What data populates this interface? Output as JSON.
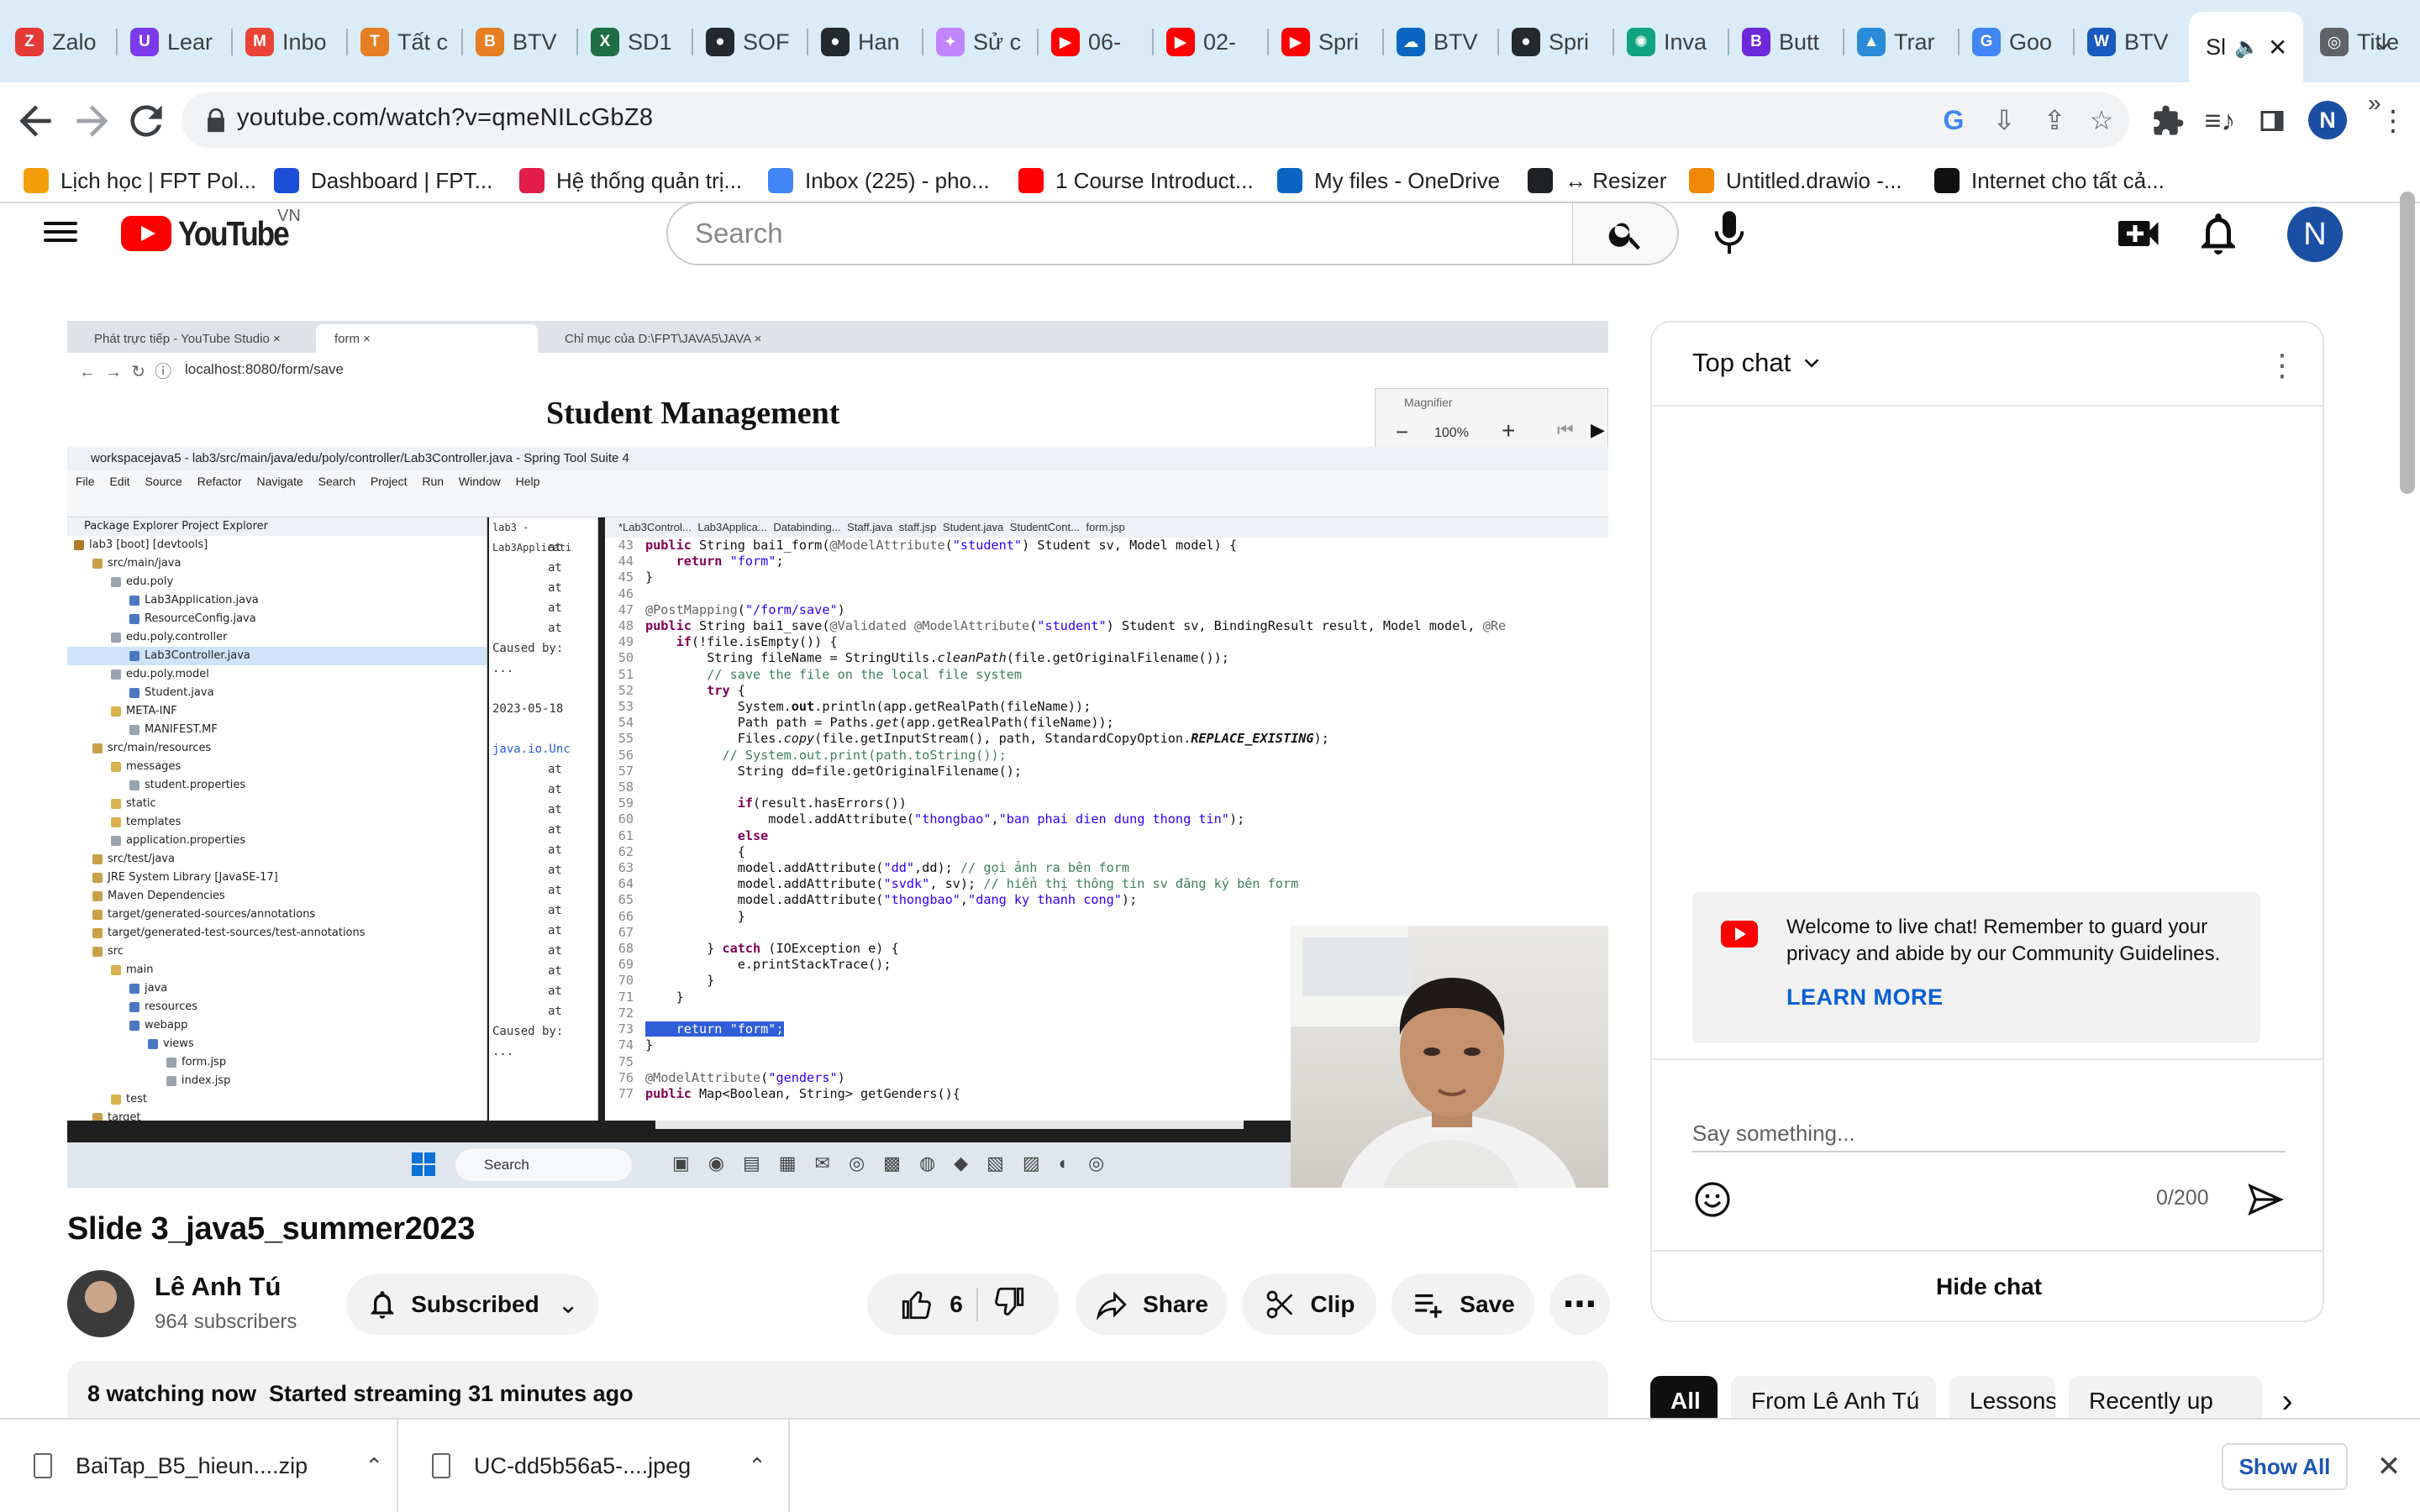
{
  "browser": {
    "tabs": [
      {
        "title": "Zalo",
        "fav": "Z",
        "color": "#e53935"
      },
      {
        "title": "Lear",
        "fav": "U",
        "color": "#7c3aed"
      },
      {
        "title": "Inbo",
        "fav": "M",
        "color": "#ea4335"
      },
      {
        "title": "Tất c",
        "fav": "T",
        "color": "#e67e22"
      },
      {
        "title": "BTV",
        "fav": "B",
        "color": "#e67e22"
      },
      {
        "title": "SD1",
        "fav": "X",
        "color": "#1d6f42"
      },
      {
        "title": "SOF",
        "fav": "●",
        "color": "#24292f"
      },
      {
        "title": "Han",
        "fav": "●",
        "color": "#24292f"
      },
      {
        "title": "Sử c",
        "fav": "✦",
        "color": "#c084fc"
      },
      {
        "title": "06-",
        "fav": "▶",
        "color": "#ff0000"
      },
      {
        "title": "02-",
        "fav": "▶",
        "color": "#ff0000"
      },
      {
        "title": "Spri",
        "fav": "▶",
        "color": "#ff0000"
      },
      {
        "title": "BTV",
        "fav": "☁",
        "color": "#0a66c2"
      },
      {
        "title": "Spri",
        "fav": "●",
        "color": "#24292f"
      },
      {
        "title": "Inva",
        "fav": "✺",
        "color": "#10a37f"
      },
      {
        "title": "Butt",
        "fav": "B",
        "color": "#6d28d9"
      },
      {
        "title": "Trar",
        "fav": "▲",
        "color": "#2a8bd8"
      },
      {
        "title": "Goo",
        "fav": "G",
        "color": "#4285f4"
      },
      {
        "title": "BTV",
        "fav": "W",
        "color": "#185abd"
      },
      {
        "title": "Sl",
        "fav": "",
        "color": "#ffffff",
        "active": true
      },
      {
        "title": "Title",
        "fav": "◎",
        "color": "#5f6368"
      }
    ],
    "url": "youtube.com/watch?v=qmeNILcGbZ8",
    "bookmarks": [
      {
        "label": "Lịch học | FPT Pol...",
        "color": "#f59e0b"
      },
      {
        "label": "Dashboard | FPT...",
        "color": "#1d4ed8"
      },
      {
        "label": "Hệ thống quản trị...",
        "color": "#e11d48"
      },
      {
        "label": "Inbox (225) - pho...",
        "color": "#4285f4"
      },
      {
        "label": "1 Course Introduct...",
        "color": "#ff0000"
      },
      {
        "label": "My files - OneDrive",
        "color": "#0a66c2"
      },
      {
        "label": "↔ Resizer",
        "color": "#202124"
      },
      {
        "label": "Untitled.drawio -...",
        "color": "#f08705"
      },
      {
        "label": "Internet cho tất cả...",
        "color": "#111111"
      }
    ],
    "more_bookmarks": "»",
    "profile_initial": "N"
  },
  "youtube": {
    "logo_text": "YouTube",
    "country_code": "VN",
    "search_placeholder": "Search",
    "avatar_initial": "N"
  },
  "video_frame": {
    "tabs": [
      "Phát trực tiếp - YouTube Studio",
      "form",
      "Chỉ mục của D:\\FPT\\JAVA5\\JAVA"
    ],
    "url": "localhost:8080/form/save",
    "heading": "Student Management",
    "magnifier_title": "Magnifier",
    "magnifier_zoom": "100%",
    "ide_title": "workspacejava5 - lab3/src/main/java/edu/poly/controller/Lab3Controller.java - Spring Tool Suite 4",
    "ide_menu": "File Edit Source Refactor Navigate Search Project Run Window Help",
    "package_explorer": "Package Explorer    Project Explorer",
    "tree": [
      {
        "t": "lab3 [boot] [devtools]",
        "d": 0
      },
      {
        "t": "src/main/java",
        "d": 1
      },
      {
        "t": "edu.poly",
        "d": 2
      },
      {
        "t": "Lab3Application.java",
        "d": 3
      },
      {
        "t": "ResourceConfig.java",
        "d": 3
      },
      {
        "t": "edu.poly.controller",
        "d": 2
      },
      {
        "t": "Lab3Controller.java",
        "d": 3
      },
      {
        "t": "edu.poly.model",
        "d": 2
      },
      {
        "t": "Student.java",
        "d": 3
      },
      {
        "t": "META-INF",
        "d": 2
      },
      {
        "t": "MANIFEST.MF",
        "d": 3
      },
      {
        "t": "src/main/resources",
        "d": 1
      },
      {
        "t": "messages",
        "d": 2
      },
      {
        "t": "student.properties",
        "d": 3
      },
      {
        "t": "static",
        "d": 2
      },
      {
        "t": "templates",
        "d": 2
      },
      {
        "t": "application.properties",
        "d": 2
      },
      {
        "t": "src/test/java",
        "d": 1
      },
      {
        "t": "JRE System Library [JavaSE-17]",
        "d": 1
      },
      {
        "t": "Maven Dependencies",
        "d": 1
      },
      {
        "t": "target/generated-sources/annotations",
        "d": 1
      },
      {
        "t": "target/generated-test-sources/test-annotations",
        "d": 1
      },
      {
        "t": "src",
        "d": 1
      },
      {
        "t": "main",
        "d": 2
      },
      {
        "t": "java",
        "d": 3
      },
      {
        "t": "resources",
        "d": 3
      },
      {
        "t": "webapp",
        "d": 3
      },
      {
        "t": "views",
        "d": 4
      },
      {
        "t": "form.jsp",
        "d": 5
      },
      {
        "t": "index.jsp",
        "d": 5
      },
      {
        "t": "test",
        "d": 2
      },
      {
        "t": "target",
        "d": 1
      }
    ],
    "editor_tabs": "*Lab3Control...   Lab3Applica...   Databinding...   Staff.java   staff.jsp   Student.java   StudentCont...   form.jsp",
    "console_lines": [
      "lab3 - Lab3Applicati",
      "at",
      "at",
      "at",
      "at",
      "at",
      "Caused by:",
      "...",
      "",
      "2023-05-18",
      "",
      "java.io.Unc",
      "at",
      "at",
      "at",
      "at",
      "at",
      "at",
      "at",
      "at",
      "at",
      "at",
      "at",
      "at",
      "at",
      "Caused by:",
      "..."
    ],
    "code": [
      {
        "n": "43",
        "html": "<span class=\"kw\">public</span> String bai1_form(<span class=\"an\">@ModelAttribute</span>(<span class=\"str\">\"student\"</span>) Student sv, Model model) {"
      },
      {
        "n": "44",
        "html": "    <span class=\"kw\">return</span> <span class=\"str\">\"form\"</span>;"
      },
      {
        "n": "45",
        "html": "}"
      },
      {
        "n": "46",
        "html": ""
      },
      {
        "n": "47",
        "html": "<span class=\"an\">@PostMapping</span>(<span class=\"str\">\"/form/save\"</span>)"
      },
      {
        "n": "48",
        "html": "<span class=\"kw\">public</span> String bai1_save(<span class=\"an\">@Validated @ModelAttribute</span>(<span class=\"str\">\"student\"</span>) Student sv, BindingResult result, Model model, <span class=\"an\">@Re</span>"
      },
      {
        "n": "49",
        "html": "    <span class=\"kw\">if</span>(!file.isEmpty()) {"
      },
      {
        "n": "50",
        "html": "        String fileName = StringUtils.<i>cleanPath</i>(file.getOriginalFilename());"
      },
      {
        "n": "51",
        "html": "        <span class=\"cm\">// save the file on the local file system</span>"
      },
      {
        "n": "52",
        "html": "        <span class=\"kw\">try</span> {"
      },
      {
        "n": "53",
        "html": "            System.<b>out</b>.println(app.getRealPath(fileName));"
      },
      {
        "n": "54",
        "html": "            Path path = Paths.<i>get</i>(app.getRealPath(fileName));"
      },
      {
        "n": "55",
        "html": "            Files.<i>copy</i>(file.getInputStream(), path, StandardCopyOption.<b><i>REPLACE_EXISTING</i></b>);"
      },
      {
        "n": "56",
        "html": "          <span class=\"cm\">// System.out.print(path.toString());</span>"
      },
      {
        "n": "57",
        "html": "            String dd=file.getOriginalFilename();"
      },
      {
        "n": "58",
        "html": ""
      },
      {
        "n": "59",
        "html": "            <span class=\"kw\">if</span>(result.hasErrors())"
      },
      {
        "n": "60",
        "html": "                model.addAttribute(<span class=\"str\">\"thongbao\"</span>,<span class=\"str\">\"ban phai dien dung thong tin\"</span>);"
      },
      {
        "n": "61",
        "html": "            <span class=\"kw\">else</span>"
      },
      {
        "n": "62",
        "html": "            {"
      },
      {
        "n": "63",
        "html": "            model.addAttribute(<span class=\"str\">\"dd\"</span>,dd); <span class=\"cm\">// gọi ảnh ra bên form</span>"
      },
      {
        "n": "64",
        "html": "            model.addAttribute(<span class=\"str\">\"svdk\"</span>, sv); <span class=\"cm\">// hiển thị thông tin sv đăng ký bên form</span>"
      },
      {
        "n": "65",
        "html": "            model.addAttribute(<span class=\"str\">\"thongbao\"</span>,<span class=\"str\">\"dang ky thanh cong\"</span>);"
      },
      {
        "n": "66",
        "html": "            }"
      },
      {
        "n": "67",
        "html": ""
      },
      {
        "n": "68",
        "html": "        } <span class=\"kw\">catch</span> (IOException e) {"
      },
      {
        "n": "69",
        "html": "            e.printStackTrace();"
      },
      {
        "n": "70",
        "html": "        }"
      },
      {
        "n": "71",
        "html": "    }"
      },
      {
        "n": "72",
        "html": ""
      },
      {
        "n": "73",
        "html": "<span class=\"hl-line\">    return \"form\";</span>"
      },
      {
        "n": "74",
        "html": "}"
      },
      {
        "n": "75",
        "html": ""
      },
      {
        "n": "76",
        "html": "<span class=\"an\">@ModelAttribute</span>(<span class=\"str\">\"genders\"</span>)"
      },
      {
        "n": "77",
        "html": "<span class=\"kw\">public</span> Map&lt;Boolean, String&gt; getGenders(){"
      }
    ],
    "taskbar_search": "Search"
  },
  "video": {
    "title": "Slide 3_java5_summer2023",
    "channel_name": "Lê Anh Tú",
    "subscribers": "964 subscribers",
    "subscribed_label": "Subscribed",
    "like_count": "6",
    "share_label": "Share",
    "clip_label": "Clip",
    "save_label": "Save",
    "watching": "8 watching now",
    "started": "Started streaming 31 minutes ago"
  },
  "chat": {
    "mode": "Top chat",
    "welcome": "Welcome to live chat! Remember to guard your privacy and abide by our Community Guidelines.",
    "learn_more": "LEARN MORE",
    "input_placeholder": "Say something...",
    "char_count": "0/200",
    "hide_chat": "Hide chat"
  },
  "chips": [
    "All",
    "From Lê Anh Tú",
    "Lessons",
    "Recently up"
  ],
  "downloads": [
    {
      "name": "BaiTap_B5_hieun....zip"
    },
    {
      "name": "UC-dd5b56a5-....jpeg"
    }
  ],
  "show_all": "Show All",
  "colors": {
    "tabstrip": "#d9ecf7",
    "youtube_red": "#ff0000",
    "link_blue": "#065fd4",
    "avatar_blue": "#1a4fa3"
  }
}
